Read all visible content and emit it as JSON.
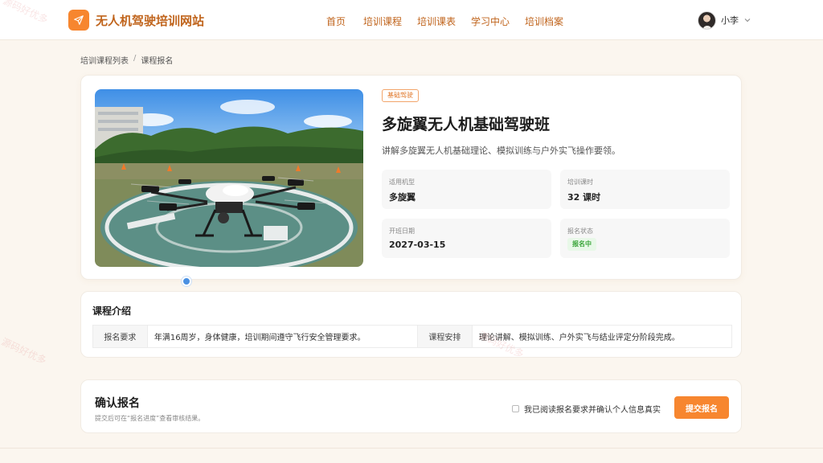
{
  "colors": {
    "accent": "#f7862f",
    "accent_text": "#c0641c",
    "page_bg": "#fbf6ef",
    "status_green": "#3aa53a",
    "dot_blue": "#4a90e2"
  },
  "header": {
    "logo_icon": "paper-plane-icon",
    "site_title": "无人机驾驶培训网站",
    "nav": [
      "首页",
      "培训课程",
      "培训课表",
      "学习中心",
      "培训档案"
    ],
    "user_name": "小李",
    "user_menu_icon": "chevron-down-icon"
  },
  "breadcrumb": {
    "parent": "培训课程列表",
    "separator": "/",
    "current": "课程报名"
  },
  "course": {
    "tag": "基础驾驶",
    "title": "多旋翼无人机基础驾驶班",
    "description": "讲解多旋翼无人机基础理论、模拟训练与户外实飞操作要领。",
    "info": {
      "aircraft_label": "适用机型",
      "aircraft_value": "多旋翼",
      "hours_label": "培训课时",
      "hours_value": "32 课时",
      "start_label": "开班日期",
      "start_value": "2027-03-15",
      "status_label": "报名状态",
      "status_value": "报名中"
    }
  },
  "intro": {
    "title": "课程介绍",
    "requirement_label": "报名要求",
    "requirement_value": "年满16周岁，身体健康，培训期间遵守飞行安全管理要求。",
    "schedule_label": "课程安排",
    "schedule_value": "理论讲解、模拟训练、户外实飞与结业评定分阶段完成。"
  },
  "confirm": {
    "title": "确认报名",
    "hint": "提交后可在“报名进度”查看审核结果。",
    "agree_text": "我已阅读报名要求并确认个人信息真实",
    "submit_label": "提交报名"
  },
  "watermark": "源码好优多"
}
